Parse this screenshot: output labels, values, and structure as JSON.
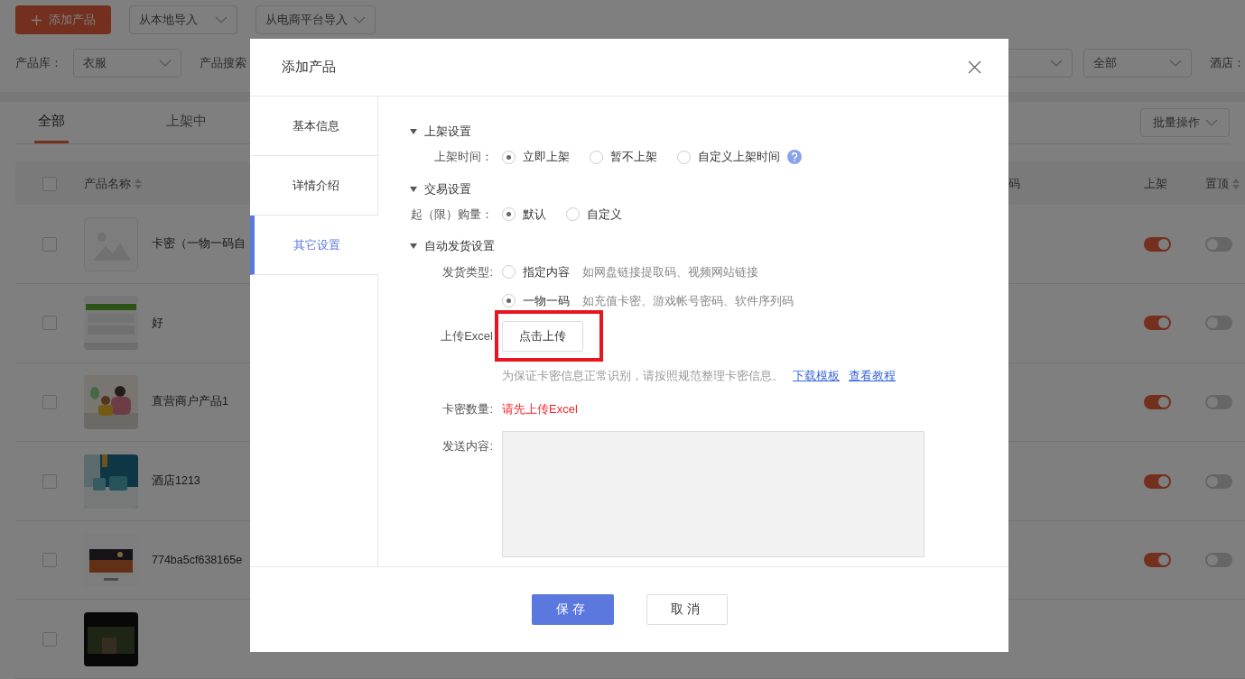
{
  "toolbar": {
    "add_button": "添加产品",
    "imports": [
      "从本地导入",
      "从电商平台导入"
    ]
  },
  "filters": {
    "library_label": "产品库：",
    "library_value": "衣服",
    "search_label": "产品搜索",
    "status_value": "全部",
    "hotel_label": "酒店："
  },
  "tabs": [
    {
      "label": "全部",
      "selected": true
    },
    {
      "label": "上架中",
      "selected": false
    }
  ],
  "batch_button": "批量操作",
  "table": {
    "all_checked": false,
    "columns": [
      {
        "label": "产品名称",
        "sortable": true
      },
      {
        "label": "码",
        "sortable": false
      },
      {
        "label": "上架",
        "sortable": false
      },
      {
        "label": "置顶",
        "sortable": true
      }
    ],
    "rows": [
      {
        "checked": false,
        "name": "卡密（一物一码自",
        "thumb": {
          "kind": "placeholder"
        },
        "listed": true,
        "pinned": false
      },
      {
        "checked": false,
        "name": "好",
        "listed": true,
        "pinned": false
      },
      {
        "checked": false,
        "name": "直营商户产品1",
        "listed": true,
        "pinned": false
      },
      {
        "checked": false,
        "name": "酒店1213",
        "listed": true,
        "pinned": false
      },
      {
        "checked": false,
        "name": "774ba5cf638165e",
        "listed": true,
        "pinned": false
      },
      {
        "checked": false
      }
    ]
  },
  "modal": {
    "title": "添加产品",
    "nav": [
      {
        "label": "基本信息",
        "selected": false
      },
      {
        "label": "详情介绍",
        "selected": false
      },
      {
        "label": "其它设置",
        "selected": true
      }
    ],
    "listing": {
      "title": "上架设置",
      "expanded": true,
      "label": "上架时间：",
      "options": [
        {
          "label": "立即上架",
          "selected": true
        },
        {
          "label": "暂不上架",
          "selected": false
        },
        {
          "label": "自定义上架时间",
          "selected": false
        }
      ]
    },
    "trade": {
      "title": "交易设置",
      "expanded": true,
      "label": "起（限）购量：",
      "options": [
        {
          "label": "默认",
          "selected": true
        },
        {
          "label": "自定义",
          "selected": false
        }
      ]
    },
    "delivery": {
      "title": "自动发货设置",
      "expanded": true,
      "type_label": "发货类型:",
      "types": [
        {
          "label": "指定内容",
          "hint": "如网盘链接提取码、视频网站链接",
          "selected": false
        },
        {
          "label": "一物一码",
          "hint": "如充值卡密、游戏帐号密码、软件序列码",
          "selected": true
        }
      ],
      "upload_label": "上传Excel",
      "upload_button": "点击上传",
      "upload_note": "为保证卡密信息正常识别，请按照规范整理卡密信息。",
      "links": [
        "下载模板",
        "查看教程"
      ],
      "count_label": "卡密数量:",
      "count_value": "请先上传Excel",
      "content_label": "发送内容:"
    },
    "save": "保存",
    "cancel": "取消"
  }
}
